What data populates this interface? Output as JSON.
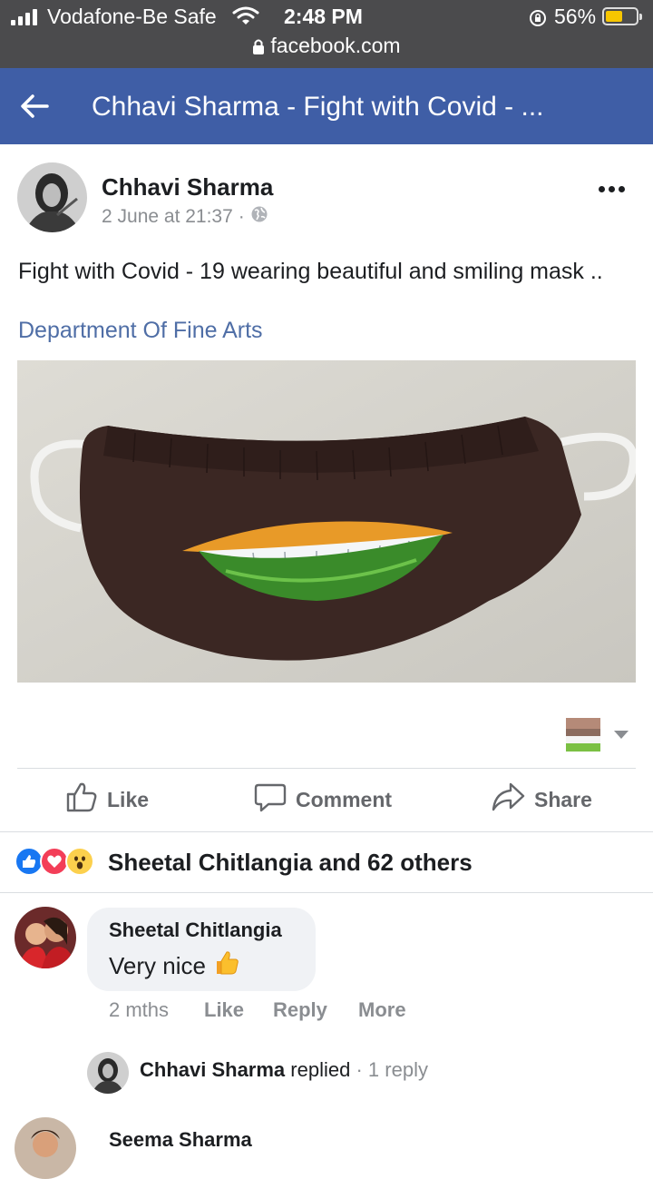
{
  "status_bar": {
    "carrier": "Vodafone-Be Safe",
    "time": "2:48 PM",
    "battery": "56%",
    "battery_level": 0.56,
    "url": "facebook.com"
  },
  "header": {
    "title": "Chhavi Sharma - Fight with Covid - ..."
  },
  "post": {
    "author": "Chhavi Sharma",
    "date": "2 June at 21:37",
    "separator": "·",
    "text": "Fight with Covid - 19 wearing beautiful and smiling mask ..",
    "page_link": "Department Of Fine Arts"
  },
  "actions": {
    "like": "Like",
    "comment": "Comment",
    "share": "Share"
  },
  "reactions": {
    "icons": [
      "like-icon",
      "love-icon",
      "wow-icon"
    ],
    "summary": "Sheetal Chitlangia and 62 others"
  },
  "comments": [
    {
      "author": "Sheetal Chitlangia",
      "text": "Very nice",
      "emoji": "thumbs-up-icon",
      "time": "2 mths",
      "like": "Like",
      "reply": "Reply",
      "more": "More"
    }
  ],
  "reply_summary": {
    "author": "Chhavi Sharma",
    "verb": "replied",
    "separator": "·",
    "count": "1 reply"
  },
  "next_comment": {
    "author": "Seema Sharma"
  },
  "colors": {
    "header_bg": "#3f5ea6",
    "status_bg": "#4b4b4d",
    "link": "#4f6ea6",
    "muted": "#8a8d91"
  }
}
